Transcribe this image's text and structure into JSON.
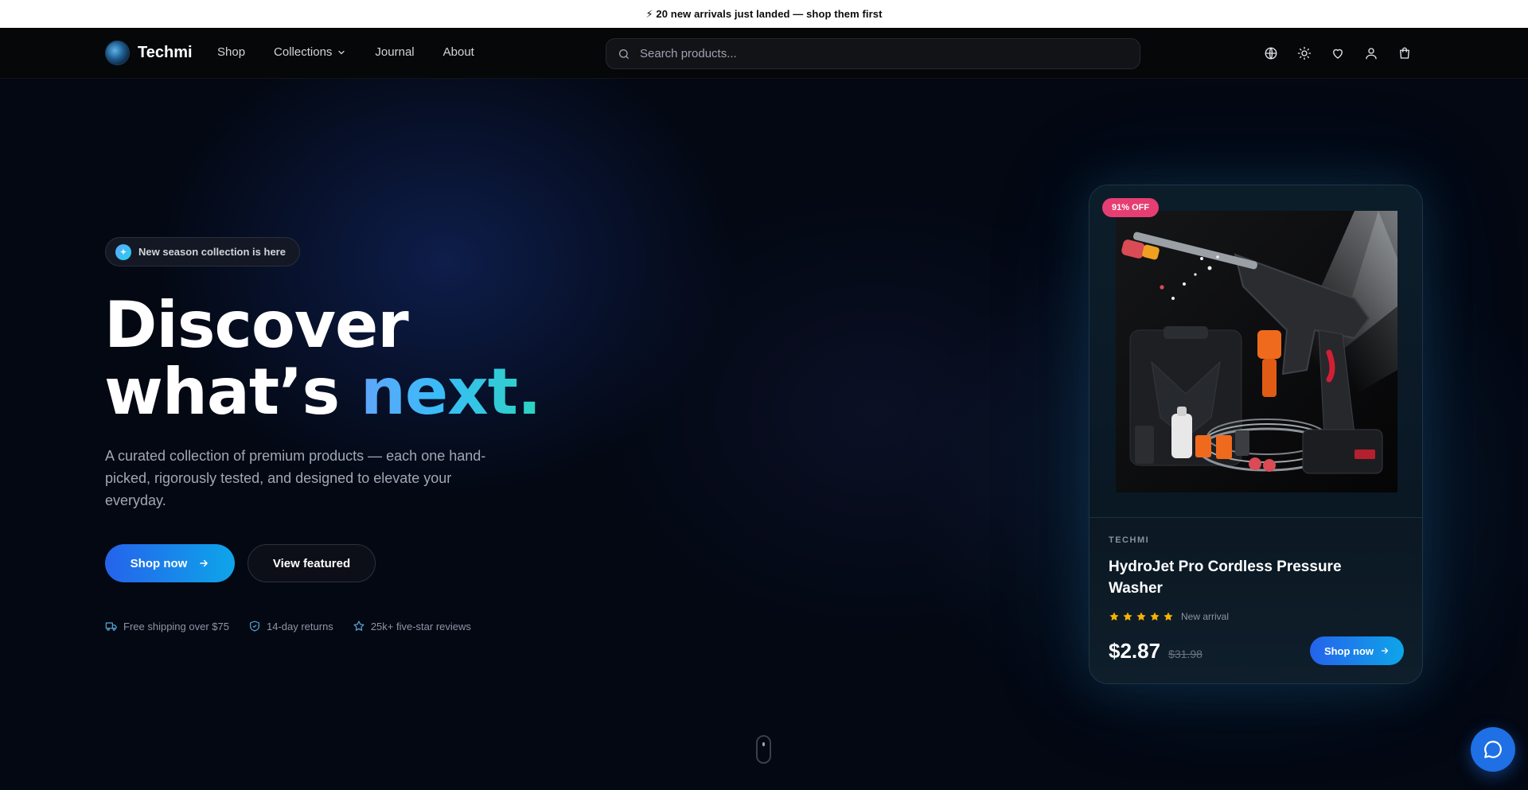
{
  "announcement": "⚡ 20 new arrivals just landed — shop them first",
  "header": {
    "brand": "Techmi",
    "nav": [
      {
        "label": "Shop"
      },
      {
        "label": "Collections"
      },
      {
        "label": "Journal"
      },
      {
        "label": "About"
      }
    ],
    "search": {
      "placeholder": "Search products..."
    },
    "icons": [
      "globe-icon",
      "sun-icon",
      "heart-icon",
      "user-icon",
      "cart-icon"
    ]
  },
  "hero": {
    "pill": "New season collection is here",
    "headline_line1": "Discover",
    "headline_line2": "what’s ",
    "headline_accent": "next.",
    "subtext": "A curated collection of premium products — each one hand-picked, rigorously tested, and designed to elevate your everyday.",
    "primary_button": "Shop now",
    "secondary_button": "View featured",
    "perks": [
      "Free shipping over $75",
      "14-day returns",
      "25k+ five-star reviews"
    ]
  },
  "product_card": {
    "discount": "91% OFF",
    "brand": "TECHMI",
    "title": "HydroJet Pro Cordless Pressure Washer",
    "rating": 5,
    "rating_label": "New arrival",
    "price": "$2.87",
    "old_price": "$31.98",
    "button": "Shop now"
  },
  "colors": {
    "accent_gradient_start": "#2563eb",
    "accent_gradient_end": "#0ea5e9",
    "discount_badge": "#e63e72",
    "star": "#f5b301",
    "chat_button": "#1f6fe5"
  }
}
